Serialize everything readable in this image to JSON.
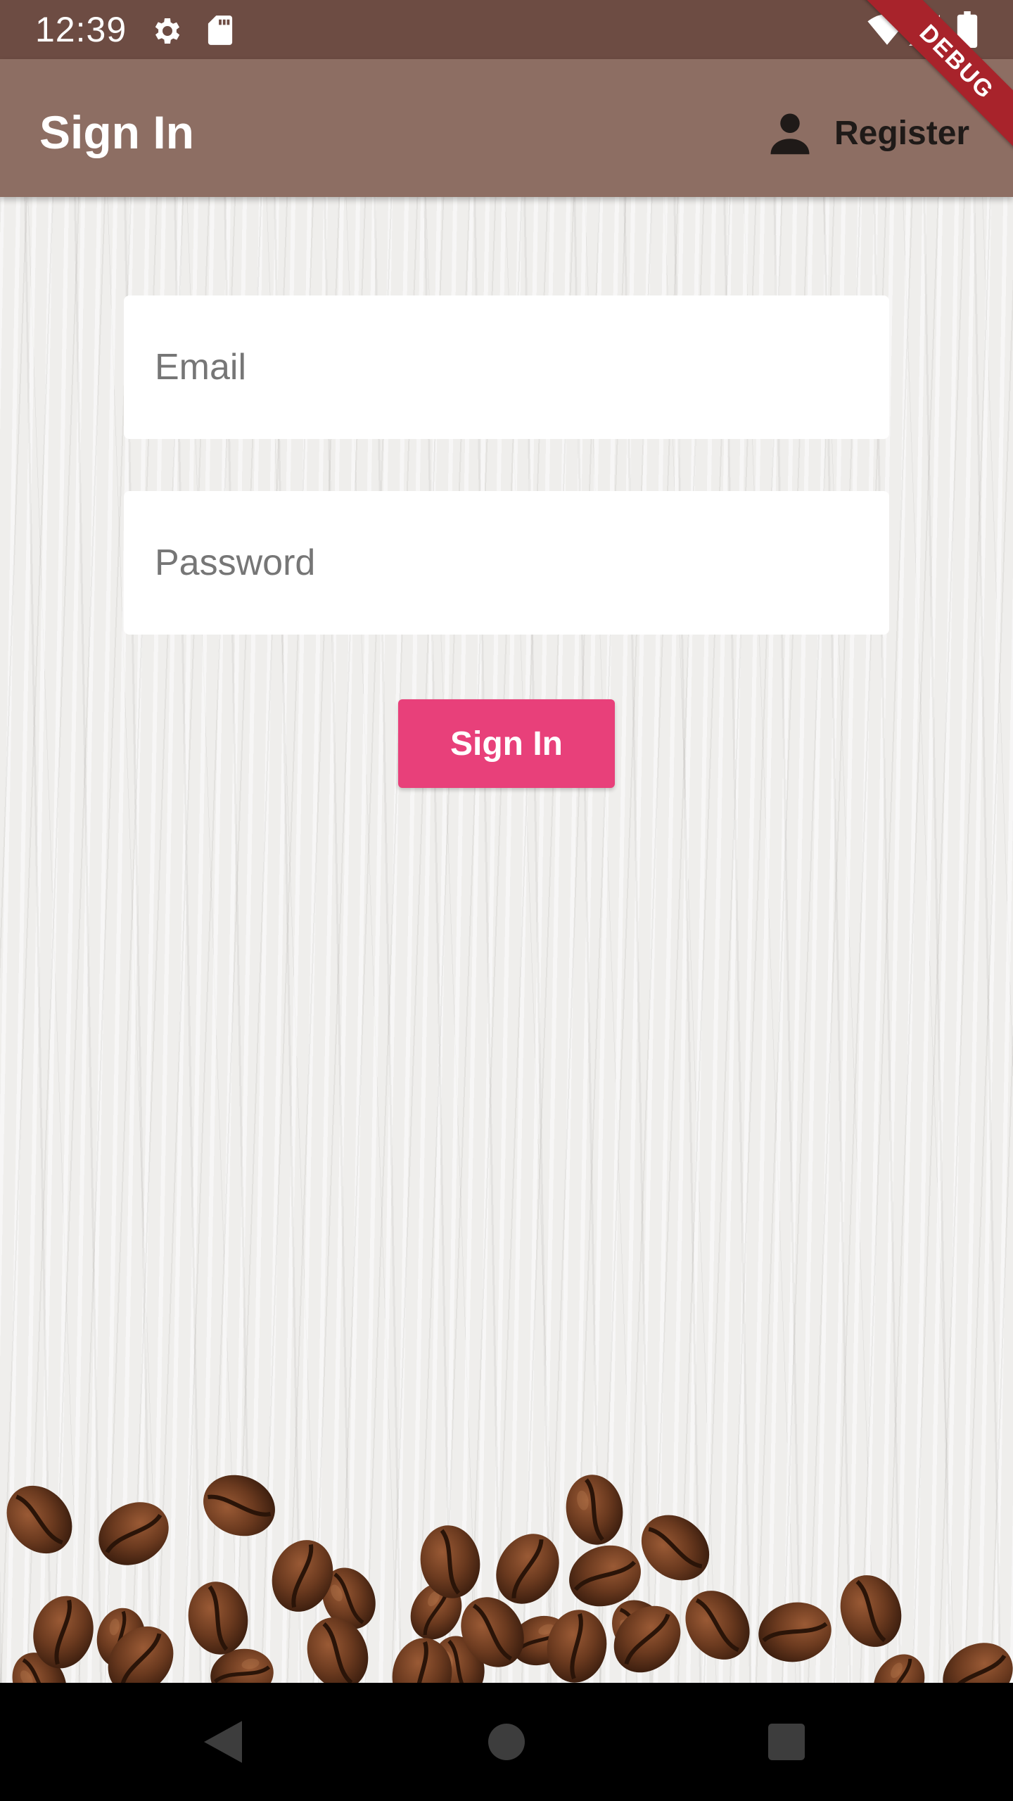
{
  "status_bar": {
    "time": "12:39",
    "icons": [
      "gear-icon",
      "sd-card-icon",
      "wifi-icon",
      "signal-icon",
      "battery-icon"
    ]
  },
  "app_bar": {
    "title": "Sign In",
    "register_label": "Register",
    "register_icon": "person-icon"
  },
  "debug_banner": "DEBUG",
  "form": {
    "email_placeholder": "Email",
    "email_value": "",
    "password_placeholder": "Password",
    "password_value": "",
    "signin_label": "Sign In"
  },
  "nav_bar": {
    "icons": [
      "back-icon",
      "home-icon",
      "recents-icon"
    ]
  },
  "colors": {
    "status_bar": "#6d4c43",
    "app_bar": "#8d6e63",
    "accent": "#e8407a",
    "debug_ribbon": "#a8232b"
  }
}
